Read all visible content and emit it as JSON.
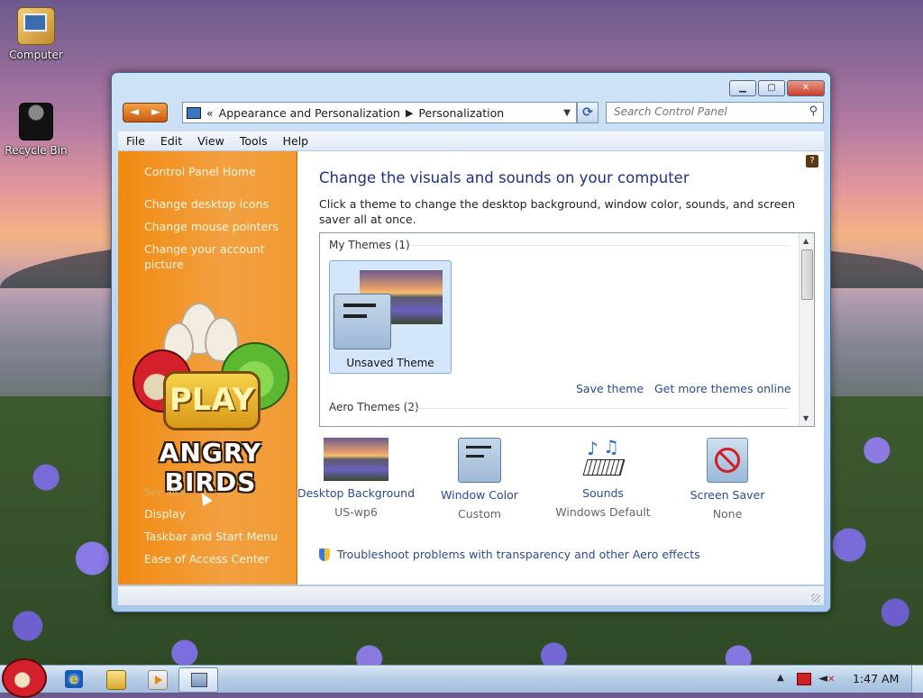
{
  "desktop": {
    "icons": [
      {
        "label": "Computer"
      },
      {
        "label": "Recycle Bin"
      }
    ]
  },
  "window": {
    "nav": {
      "back": "◄",
      "forward": "►"
    },
    "address": {
      "prefix": "«",
      "crumbs": [
        "Appearance and Personalization",
        "Personalization"
      ]
    },
    "search": {
      "placeholder": "Search Control Panel"
    },
    "menu": [
      "File",
      "Edit",
      "View",
      "Tools",
      "Help"
    ],
    "left": {
      "home": "Control Panel Home",
      "links": [
        "Change desktop icons",
        "Change mouse pointers",
        "Change your account picture"
      ],
      "see_also": "See also",
      "bottom_links": [
        "Display",
        "Taskbar and Start Menu",
        "Ease of Access Center"
      ],
      "promo": {
        "button": "PLAY",
        "title": "ANGRY BIRDS"
      }
    },
    "main": {
      "title": "Change the visuals and sounds on your computer",
      "description": "Click a theme to change the desktop background, window color, sounds, and screen saver all at once.",
      "themes": {
        "my_header": "My Themes (1)",
        "aero_header": "Aero Themes (2)",
        "tile_name": "Unsaved Theme",
        "save_link": "Save theme",
        "get_more_link": "Get more themes online"
      },
      "options": [
        {
          "label": "Desktop Background",
          "value": "US-wp6"
        },
        {
          "label": "Window Color",
          "value": "Custom"
        },
        {
          "label": "Sounds",
          "value": "Windows Default"
        },
        {
          "label": "Screen Saver",
          "value": "None"
        }
      ],
      "troubleshoot": "Troubleshoot problems with transparency and other Aero effects"
    }
  },
  "taskbar": {
    "clock": "1:47 AM"
  }
}
